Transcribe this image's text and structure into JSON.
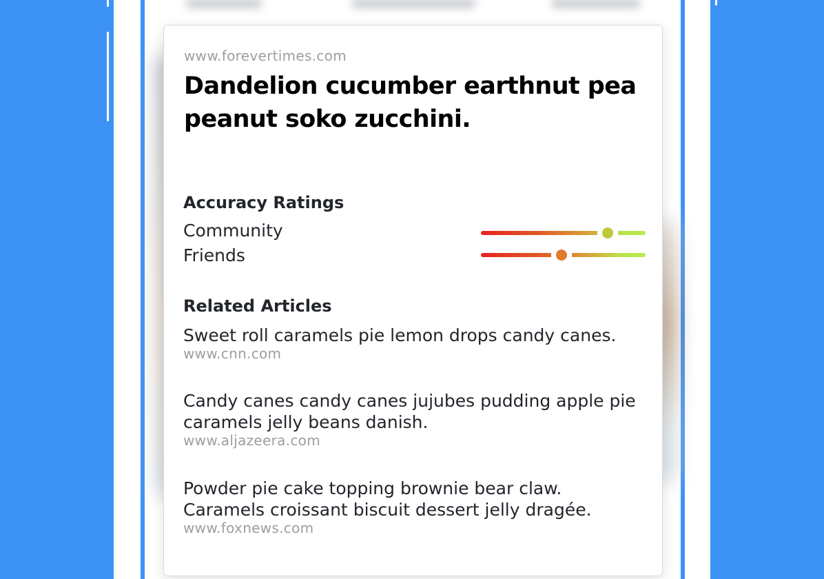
{
  "article": {
    "source_url": "www.forevertimes.com",
    "headline": "Dandelion cucumber earthnut pea peanut soko zucchini."
  },
  "accuracy": {
    "title": "Accuracy Ratings",
    "ratings": [
      {
        "label": "Community",
        "level": 0.77,
        "thumb_color": "#bdc93a"
      },
      {
        "label": "Friends",
        "level": 0.49,
        "thumb_color": "#e07a2c"
      }
    ]
  },
  "related": {
    "title": "Related Articles",
    "items": [
      {
        "title": "Sweet roll caramels pie lemon drops candy canes.",
        "url": "www.cnn.com"
      },
      {
        "title": "Candy canes candy canes jujubes pudding apple pie caramels jelly beans danish.",
        "url": "www.aljazeera.com"
      },
      {
        "title": "Powder pie cake topping brownie bear claw. Caramels croissant biscuit dessert jelly dragée.",
        "url": "www.foxnews.com"
      }
    ]
  },
  "colors": {
    "background": "#3d92f5",
    "track_start": "#e8201f",
    "track_end": "#b8ea52"
  }
}
